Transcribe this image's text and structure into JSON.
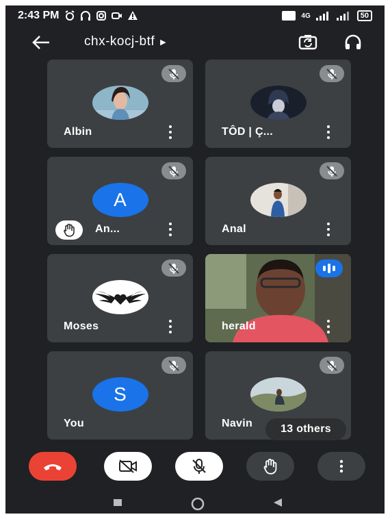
{
  "status_bar": {
    "time": "2:43 PM",
    "network_label": "4G",
    "battery": "50"
  },
  "header": {
    "meeting_code": "chx-kocj-btf",
    "back_icon": "arrow-left-icon",
    "switch_camera_icon": "switch-camera-icon",
    "audio_icon": "headphones-icon"
  },
  "participants": [
    {
      "name": "Albin",
      "avatar": "photo"
    },
    {
      "name": "TÔD | Ç...",
      "avatar": "photo"
    },
    {
      "name": "An...",
      "avatar": "letter",
      "letter": "A",
      "hand_raised": true
    },
    {
      "name": "Anal",
      "avatar": "photo"
    },
    {
      "name": "Moses",
      "avatar": "photo"
    },
    {
      "name": "herald",
      "avatar": "video",
      "speaking": true
    },
    {
      "name": "You",
      "avatar": "letter",
      "letter": "S"
    },
    {
      "name": "Navin",
      "avatar": "photo"
    }
  ],
  "others_label": "13 others",
  "controls": [
    "end-call-icon",
    "camera-off-icon",
    "mic-off-icon",
    "raise-hand-icon",
    "more-vertical-icon"
  ],
  "colors": {
    "background": "#202124",
    "tile": "#3c4043",
    "end_call": "#ea4335",
    "accent": "#1a73e8",
    "mute_badge": "#8a8d90"
  }
}
